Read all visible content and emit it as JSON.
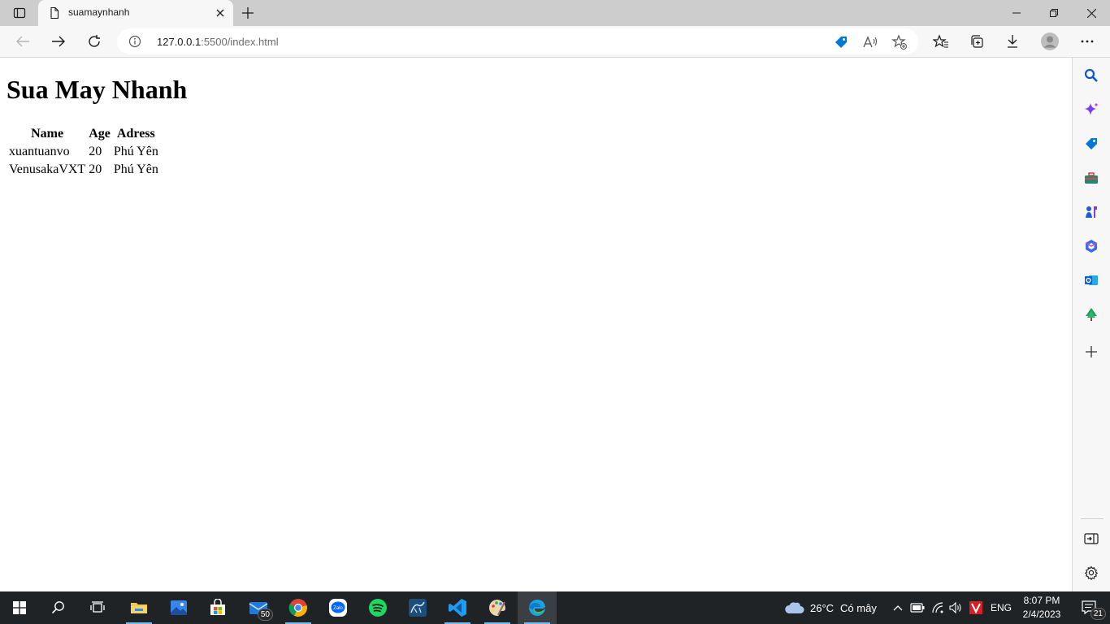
{
  "browser": {
    "tab": {
      "title": "suamaynhanh"
    },
    "address": {
      "url_host": "127.0.0.1",
      "url_rest": ":5500/index.html"
    }
  },
  "page": {
    "heading": "Sua May Nhanh",
    "table": {
      "headers": [
        "Name",
        "Age",
        "Adress"
      ],
      "rows": [
        [
          "xuantuanvo",
          "20",
          "Phú Yên"
        ],
        [
          "VenusakaVXT",
          "20",
          "Phú Yên"
        ]
      ]
    }
  },
  "taskbar": {
    "mail_badge": "50",
    "weather": {
      "temp": "26°C",
      "desc": "Có mây"
    },
    "lang": "ENG",
    "time": "8:07 PM",
    "date": "2/4/2023",
    "notif_count": "21"
  },
  "colors": {
    "accent": "#0078d4",
    "taskbar": "#202326"
  }
}
